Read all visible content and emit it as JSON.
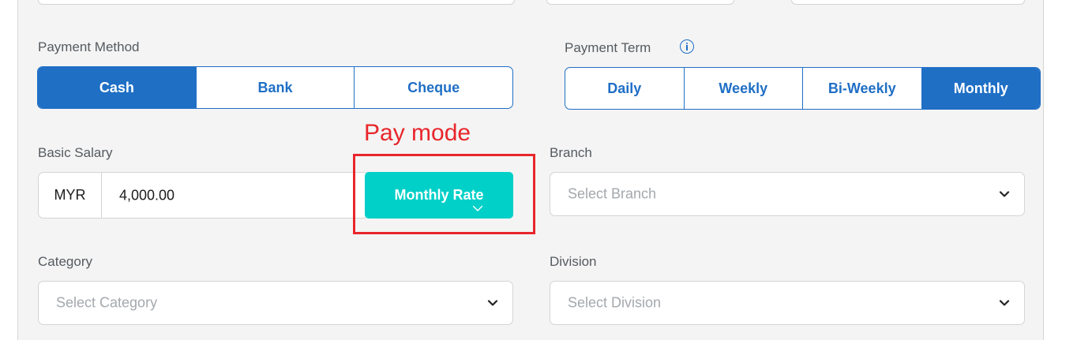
{
  "payment_method": {
    "label": "Payment Method",
    "options": [
      "Cash",
      "Bank",
      "Cheque"
    ],
    "selected": "Cash"
  },
  "payment_term": {
    "label": "Payment Term",
    "options": [
      "Daily",
      "Weekly",
      "Bi-Weekly",
      "Monthly"
    ],
    "selected": "Monthly"
  },
  "basic_salary": {
    "label": "Basic Salary",
    "currency": "MYR",
    "value": "4,000.00",
    "rate_button": "Monthly Rate"
  },
  "annotation": {
    "text": "Pay mode",
    "color": "#e8262b"
  },
  "branch": {
    "label": "Branch",
    "placeholder": "Select Branch"
  },
  "category": {
    "label": "Category",
    "placeholder": "Select Category"
  },
  "division": {
    "label": "Division",
    "placeholder": "Select Division"
  },
  "colors": {
    "accent": "#1f6fc5",
    "teal": "#00d0c8"
  }
}
